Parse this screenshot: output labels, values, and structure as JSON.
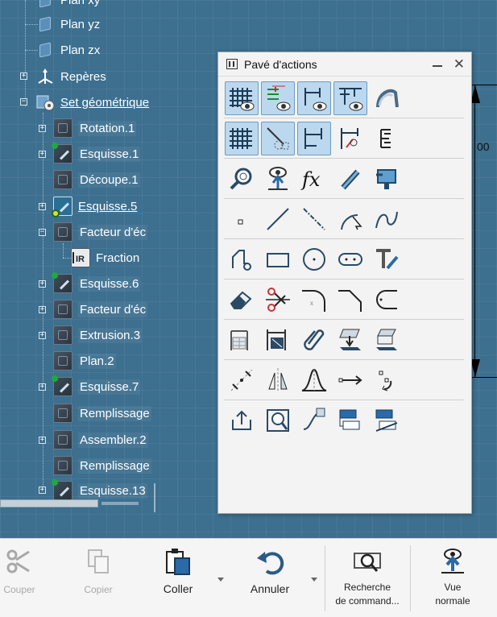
{
  "tree": {
    "items": [
      {
        "label": "Plan xy"
      },
      {
        "label": "Plan yz"
      },
      {
        "label": "Plan zx"
      },
      {
        "label": "Repères"
      },
      {
        "label": "Set géométrique"
      },
      {
        "label": "Rotation.1"
      },
      {
        "label": "Esquisse.1"
      },
      {
        "label": "Découpe.1"
      },
      {
        "label": "Esquisse.5"
      },
      {
        "label": "Facteur d'éc"
      },
      {
        "label": "Fraction"
      },
      {
        "label": "Esquisse.6"
      },
      {
        "label": "Facteur d'éc"
      },
      {
        "label": "Extrusion.3"
      },
      {
        "label": "Plan.2"
      },
      {
        "label": "Esquisse.7"
      },
      {
        "label": "Remplissage"
      },
      {
        "label": "Assembler.2"
      },
      {
        "label": "Remplissage"
      },
      {
        "label": "Esquisse.13"
      }
    ]
  },
  "dimension": {
    "value": "00"
  },
  "action_pad": {
    "title": "Pavé d'actions",
    "rows": [
      [
        "grid-view-icon",
        "constraint-view-icon",
        "dimension-view-icon",
        "geometry-view-icon",
        "sketch-analysis-icon"
      ],
      [
        "grid-snap-icon",
        "construction-element-icon",
        "dimensional-constraint-icon",
        "constraint-dialog-icon",
        "expand-icon"
      ],
      [
        "inspect-icon",
        "normal-view-icon",
        "formula-icon",
        "tool-icon",
        "project-icon"
      ],
      [
        "point-icon",
        "line-icon",
        "axis-icon",
        "arc-icon",
        "spline-icon"
      ],
      [
        "profile-icon",
        "rectangle-icon",
        "circle-icon",
        "oblong-icon",
        "text-icon"
      ],
      [
        "eraser-icon",
        "trim-icon",
        "corner-icon",
        "chamfer-icon",
        "connect-icon"
      ],
      [
        "dimension-table-icon",
        "fix-dimension-icon",
        "clip-icon",
        "project-down-icon",
        "intersect-icon"
      ],
      [
        "symmetry-center-icon",
        "mirror-icon",
        "bell-curve-icon",
        "translate-icon",
        "rotate-icon"
      ],
      [
        "export-icon",
        "search-sketch-icon",
        "sweep-icon",
        "output-feature-icon",
        "output-feature-2-icon"
      ]
    ]
  },
  "toolbar": {
    "cut": "Couper",
    "copy": "Copier",
    "paste": "Coller",
    "undo": "Annuler",
    "search_line1": "Recherche",
    "search_line2": "de command...",
    "view_line1": "Vue",
    "view_line2": "normale"
  }
}
